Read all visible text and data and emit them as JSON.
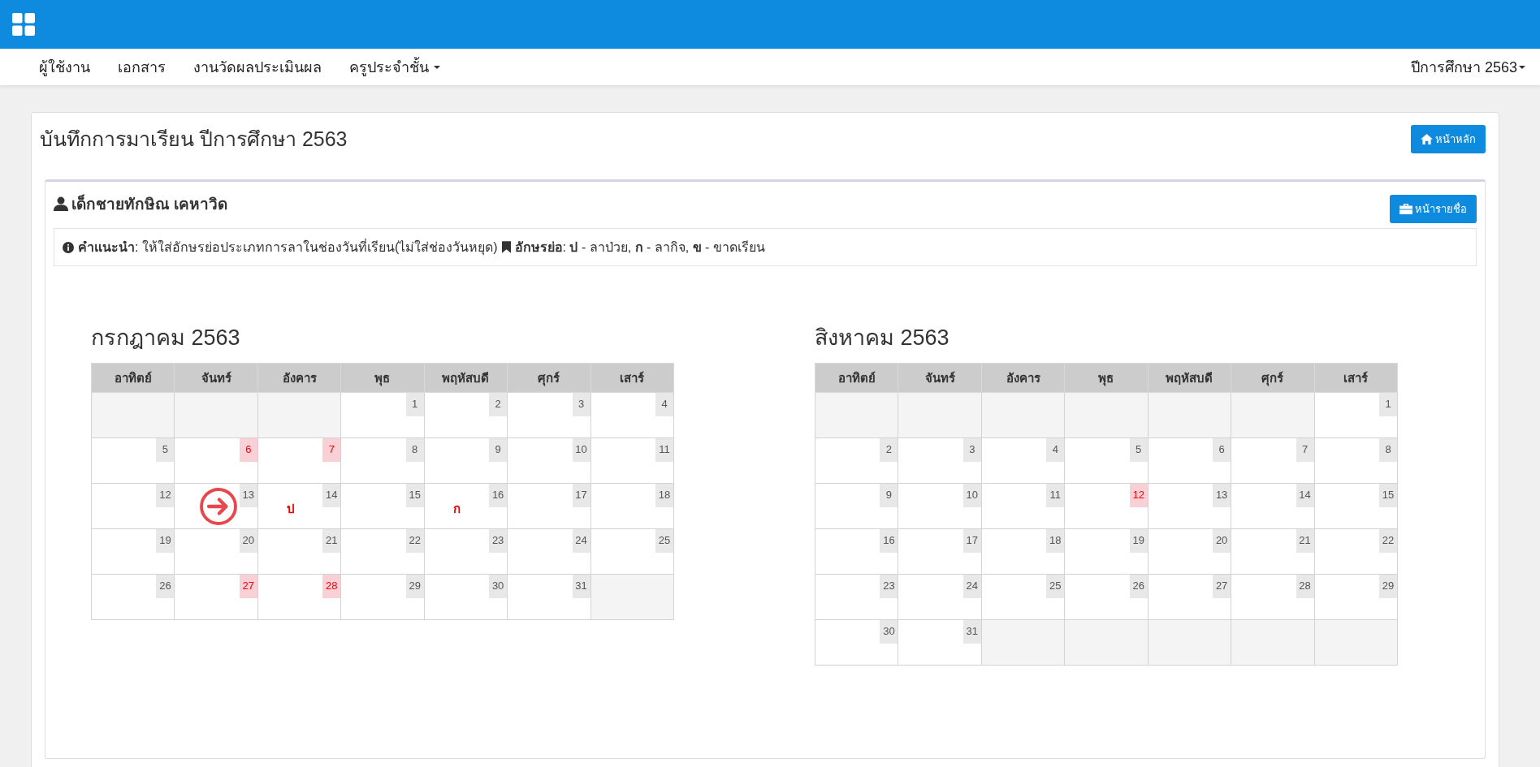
{
  "navbar": {
    "items": [
      {
        "label": "ผู้ใช้งาน",
        "dropdown": false
      },
      {
        "label": "เอกสาร",
        "dropdown": false
      },
      {
        "label": "งานวัดผลประเมินผล",
        "dropdown": false
      },
      {
        "label": "ครูประจำชั้น",
        "dropdown": true
      }
    ],
    "year_menu": "ปีการศึกษา 2563"
  },
  "page": {
    "title": "บันทึกการมาเรียน ปีการศึกษา 2563",
    "home_button": "หน้าหลัก"
  },
  "student": {
    "name": "เด็กชายทักษิณ เคหาวิด",
    "list_button": "หน้ารายชื่อ",
    "hint": "**คำแนะนำ**: ให้ใส่อักษรย่อประเภทการลาในช่องวันที่เรียน(ไม่ใส่ช่องวันหยุด)",
    "legend": "**อักษรย่อ**: **ป** - ลาป่วย, **ก** - ลากิจ, **ข** - ขาดเรียน"
  },
  "calendars": [
    {
      "title": "กรกฎาคม 2563",
      "weekdays": [
        "อาทิตย์",
        "จันทร์",
        "อังคาร",
        "พุธ",
        "พฤหัสบดี",
        "ศุกร์",
        "เสาร์"
      ],
      "weeks": [
        [
          {
            "kind": "blank"
          },
          {
            "kind": "blank"
          },
          {
            "kind": "blank"
          },
          {
            "day": "1",
            "holiday": false
          },
          {
            "day": "2",
            "holiday": false
          },
          {
            "day": "3",
            "holiday": false
          },
          {
            "day": "4",
            "holiday": false
          }
        ],
        [
          {
            "day": "5",
            "holiday": false
          },
          {
            "day": "6",
            "holiday": true
          },
          {
            "day": "7",
            "holiday": true
          },
          {
            "day": "8",
            "holiday": false
          },
          {
            "day": "9",
            "holiday": false
          },
          {
            "day": "10",
            "holiday": false
          },
          {
            "day": "11",
            "holiday": false
          }
        ],
        [
          {
            "day": "12",
            "holiday": false
          },
          {
            "day": "13",
            "holiday": false,
            "pointer": true
          },
          {
            "day": "14",
            "holiday": false,
            "mark": "ป"
          },
          {
            "day": "15",
            "holiday": false
          },
          {
            "day": "16",
            "holiday": false,
            "mark": "ก"
          },
          {
            "day": "17",
            "holiday": false
          },
          {
            "day": "18",
            "holiday": false
          }
        ],
        [
          {
            "day": "19",
            "holiday": false
          },
          {
            "day": "20",
            "holiday": false
          },
          {
            "day": "21",
            "holiday": false
          },
          {
            "day": "22",
            "holiday": false
          },
          {
            "day": "23",
            "holiday": false
          },
          {
            "day": "24",
            "holiday": false
          },
          {
            "day": "25",
            "holiday": false
          }
        ],
        [
          {
            "day": "26",
            "holiday": false
          },
          {
            "day": "27",
            "holiday": true
          },
          {
            "day": "28",
            "holiday": true
          },
          {
            "day": "29",
            "holiday": false
          },
          {
            "day": "30",
            "holiday": false
          },
          {
            "day": "31",
            "holiday": false
          },
          {
            "kind": "blank"
          }
        ]
      ]
    },
    {
      "title": "สิงหาคม 2563",
      "weekdays": [
        "อาทิตย์",
        "จันทร์",
        "อังคาร",
        "พุธ",
        "พฤหัสบดี",
        "ศุกร์",
        "เสาร์"
      ],
      "weeks": [
        [
          {
            "kind": "blank"
          },
          {
            "kind": "blank"
          },
          {
            "kind": "blank"
          },
          {
            "kind": "blank"
          },
          {
            "kind": "blank"
          },
          {
            "kind": "blank"
          },
          {
            "day": "1",
            "holiday": false
          }
        ],
        [
          {
            "day": "2",
            "holiday": false
          },
          {
            "day": "3",
            "holiday": false
          },
          {
            "day": "4",
            "holiday": false
          },
          {
            "day": "5",
            "holiday": false
          },
          {
            "day": "6",
            "holiday": false
          },
          {
            "day": "7",
            "holiday": false
          },
          {
            "day": "8",
            "holiday": false
          }
        ],
        [
          {
            "day": "9",
            "holiday": false
          },
          {
            "day": "10",
            "holiday": false
          },
          {
            "day": "11",
            "holiday": false
          },
          {
            "day": "12",
            "holiday": true
          },
          {
            "day": "13",
            "holiday": false
          },
          {
            "day": "14",
            "holiday": false
          },
          {
            "day": "15",
            "holiday": false
          }
        ],
        [
          {
            "day": "16",
            "holiday": false
          },
          {
            "day": "17",
            "holiday": false
          },
          {
            "day": "18",
            "holiday": false
          },
          {
            "day": "19",
            "holiday": false
          },
          {
            "day": "20",
            "holiday": false
          },
          {
            "day": "21",
            "holiday": false
          },
          {
            "day": "22",
            "holiday": false
          }
        ],
        [
          {
            "day": "23",
            "holiday": false
          },
          {
            "day": "24",
            "holiday": false
          },
          {
            "day": "25",
            "holiday": false
          },
          {
            "day": "26",
            "holiday": false
          },
          {
            "day": "27",
            "holiday": false
          },
          {
            "day": "28",
            "holiday": false
          },
          {
            "day": "29",
            "holiday": false
          }
        ],
        [
          {
            "day": "30",
            "holiday": false
          },
          {
            "day": "31",
            "holiday": false
          },
          {
            "kind": "blank"
          },
          {
            "kind": "blank"
          },
          {
            "kind": "blank"
          },
          {
            "kind": "blank"
          },
          {
            "kind": "blank"
          }
        ]
      ]
    }
  ]
}
